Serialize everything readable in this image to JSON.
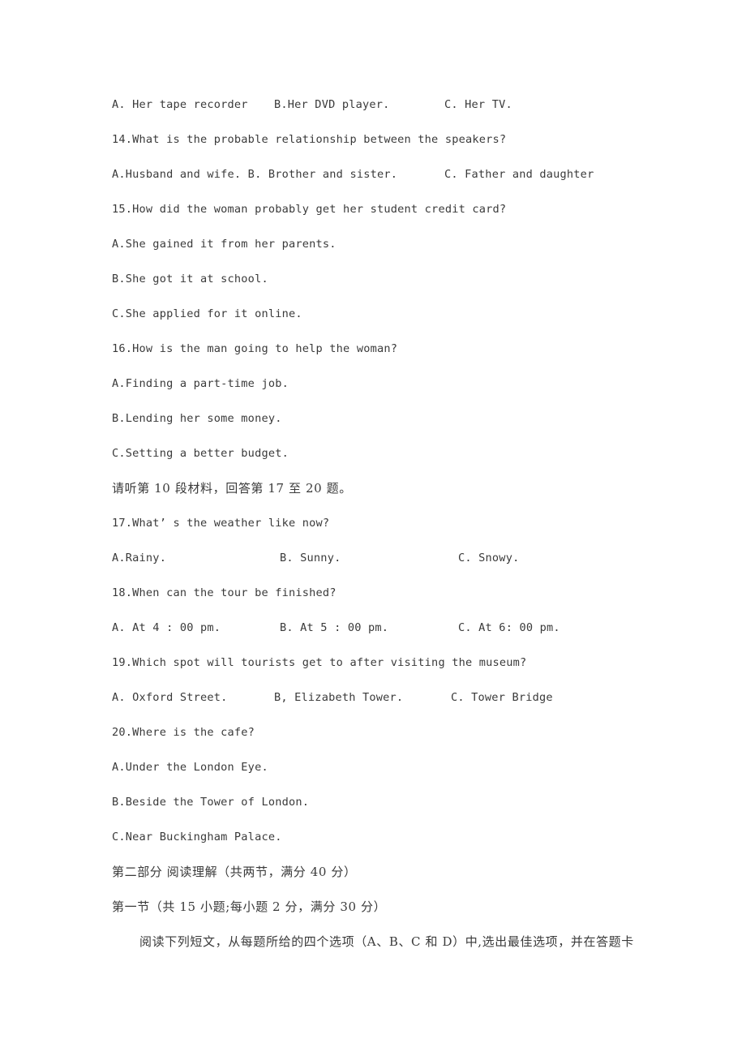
{
  "document": {
    "type": "exam-paper-page",
    "language": "zh-CN + en",
    "background_color": "#ffffff",
    "text_color": "#3a3a3a"
  },
  "lines": {
    "q13_options": {
      "a": "A.  Her tape recorder",
      "b": "B.Her DVD player.",
      "c": "C.  Her TV."
    },
    "q14_stem": "14.What is the probable relationship between the speakers?",
    "q14_options": {
      "ab": "A.Husband and wife. B. Brother and sister.",
      "c": "C.  Father and daughter"
    },
    "q15_stem": "15.How did the woman probably get her student credit card?",
    "q15_option_a": "A.She gained it from her parents.",
    "q15_option_b": "B.She got it at school.",
    "q15_option_c": "C.She applied for it online.",
    "q16_stem": "16.How is the man going to help the woman?",
    "q16_option_a": "A.Finding a part-time job.",
    "q16_option_b": "B.Lending her some money.",
    "q16_option_c": "C.Setting a better budget.",
    "listening_prompt_10": "请听第 10 段材料，回答第 17 至 20 题。",
    "q17_stem": "17.What’ s the weather like now?",
    "q17_options": {
      "a": "A.Rainy.",
      "b": "B.  Sunny.",
      "c": "C.  Snowy."
    },
    "q18_stem": "18.When can the tour be finished?",
    "q18_options": {
      "a": "A.  At 4 : 00 pm.",
      "b": "B.  At 5 : 00 pm.",
      "c": "C.  At 6: 00 pm."
    },
    "q19_stem": "19.Which spot will tourists get to after visiting the museum?",
    "q19_options": {
      "a": "A.  Oxford Street.",
      "b": "B, Elizabeth Tower.",
      "c": "C.  Tower Bridge"
    },
    "q20_stem": "20.Where is the cafe?",
    "q20_option_a": "A.Under the London Eye.",
    "q20_option_b": "B.Beside the Tower of London.",
    "q20_option_c": "C.Near Buckingham Palace.",
    "part_two_heading": "第二部分 阅读理解（共两节，满分 40 分）",
    "section_one_heading": "第一节（共 15 小题;每小题 2 分，满分 30 分）",
    "section_one_instruction": "阅读下列短文，从每题所给的四个选项（A、B、C 和 D）中,选出最佳选项，并在答题卡"
  }
}
